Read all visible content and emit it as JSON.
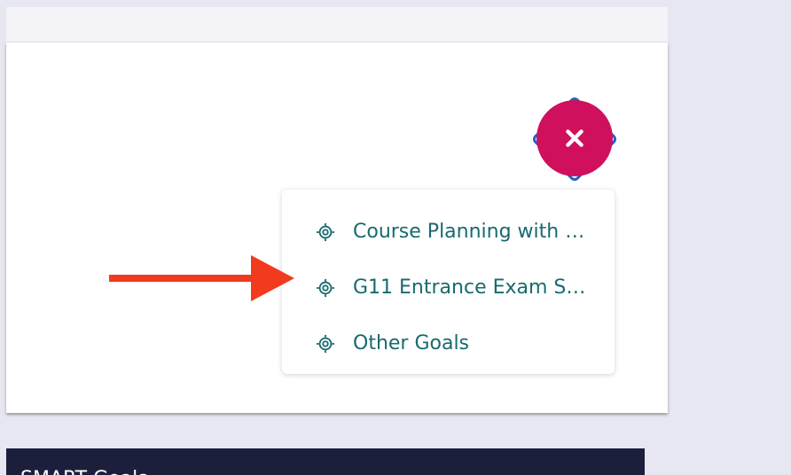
{
  "fab": {
    "icon": "close-icon",
    "color": "#d0105d",
    "focus_color": "#1f62c9"
  },
  "goal_menu": {
    "items": [
      {
        "label": "Course Planning with …",
        "icon": "target-icon"
      },
      {
        "label": "G11 Entrance Exam S…",
        "icon": "target-icon"
      },
      {
        "label": "Other Goals",
        "icon": "target-icon"
      }
    ],
    "text_color": "#176a6f"
  },
  "annotation": {
    "arrow_color": "#f23a1e",
    "points_to": "G11 Entrance Exam S…"
  },
  "bottom_bar": {
    "title": "SMART Goals"
  }
}
